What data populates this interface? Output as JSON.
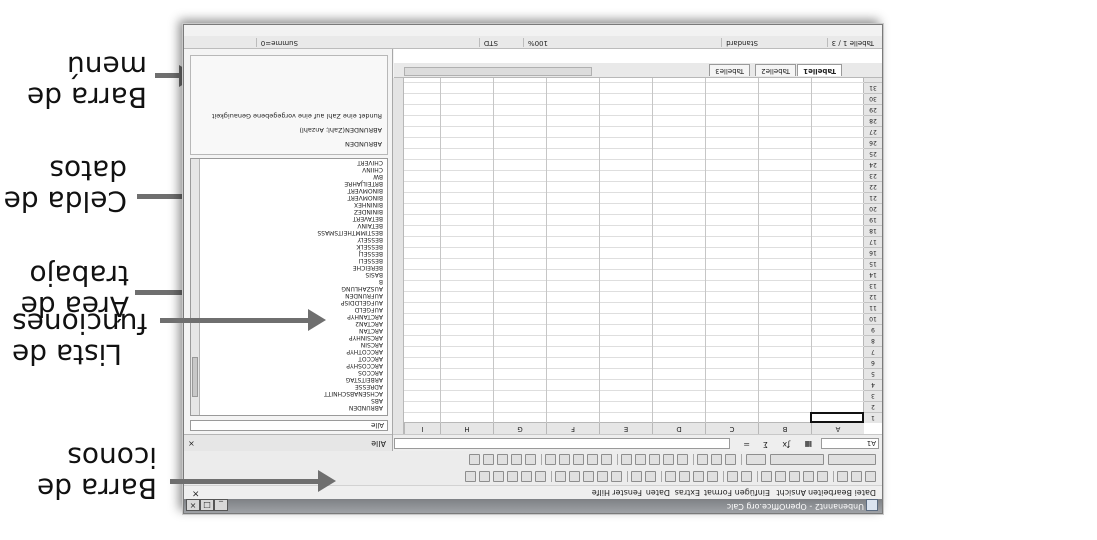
{
  "callouts": {
    "barra_menu": [
      "Barra de",
      "menú"
    ],
    "celda_datos": [
      "Celda de",
      "datos"
    ],
    "area_trabajo": [
      "Área de",
      "trabajo"
    ],
    "barra_iconos": [
      "Barra de",
      "iconos"
    ],
    "lista_funciones": [
      "Lista de",
      "funciones"
    ]
  },
  "window": {
    "title": "Unbenannt2 - OpenOffice.org Calc",
    "menu": [
      "Datei",
      "Bearbeiten",
      "Ansicht",
      "Einfügen",
      "Format",
      "Extras",
      "Daten",
      "Fenster",
      "Hilfe"
    ],
    "name_box": "A1",
    "columns": [
      "A",
      "B",
      "C",
      "D",
      "E",
      "F",
      "G",
      "H",
      "I"
    ],
    "rows": [
      "1",
      "2",
      "3",
      "4",
      "5",
      "6",
      "7",
      "8",
      "9",
      "10",
      "11",
      "12",
      "13",
      "14",
      "15",
      "16",
      "17",
      "18",
      "19",
      "20",
      "21",
      "22",
      "23",
      "24",
      "25",
      "26",
      "27",
      "28",
      "29",
      "30",
      "31"
    ],
    "sheet_tabs": [
      "Tabelle1",
      "Tabelle2",
      "Tabelle3"
    ],
    "status": {
      "sheet": "Tabelle 1 / 3",
      "style": "Standard",
      "zoom": "100%",
      "mode": "STD",
      "sum": "Summe=0"
    }
  },
  "function_panel": {
    "title": "Alle",
    "category": "Alle",
    "functions": [
      "ABRUNDEN",
      "ABS",
      "ACHSENABSCHNITT",
      "ADRESSE",
      "ARBEITSTAG",
      "ARCCOS",
      "ARCCOSHYP",
      "ARCCOT",
      "ARCCOTHYP",
      "ARCSIN",
      "ARCSINHYP",
      "ARCTAN",
      "ARCTAN2",
      "ARCTANHYP",
      "AUFGELD",
      "AUFGELDDISP",
      "AUFRUNDEN",
      "AUSZAHLUNG",
      "B",
      "BASIS",
      "BEREICHE",
      "BESSELI",
      "BESSELJ",
      "BESSELK",
      "BESSELY",
      "BESTIMMTHEITSMASS",
      "BETAINV",
      "BETAVERT",
      "BININDEZ",
      "BININHEX",
      "BINOMVERT",
      "BINOMVERT",
      "BRTEILJAHRE",
      "BW",
      "CHIINV",
      "CHIVERT"
    ],
    "detail_name": "ABRUNDEN",
    "detail_syntax": "ABRUNDEN(Zahl; Anzahl)",
    "detail_desc": "Rundet eine Zahl auf eine vorgegebene Genauigkeit"
  }
}
